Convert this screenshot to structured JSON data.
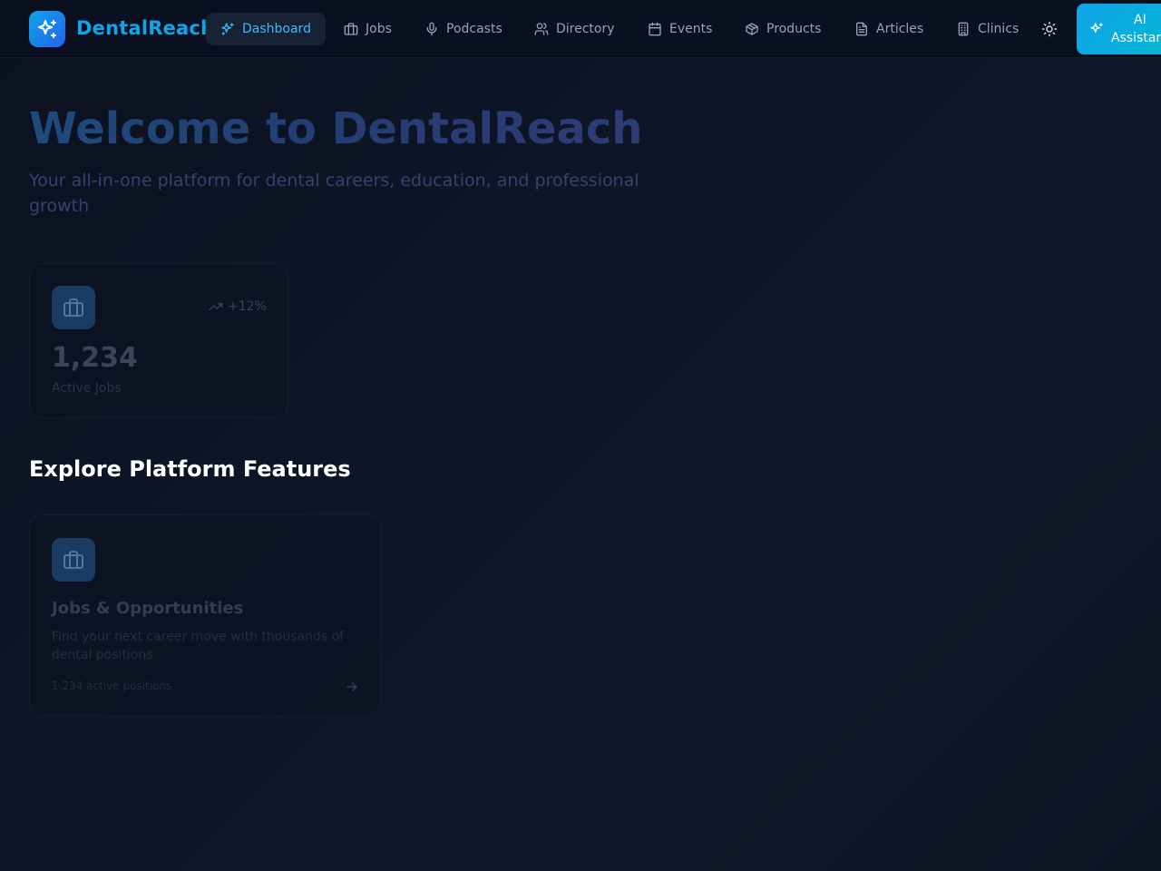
{
  "header": {
    "brand": "DentalReach",
    "nav": [
      {
        "label": "Dashboard",
        "icon": "sparkles-icon",
        "active": true
      },
      {
        "label": "Jobs",
        "icon": "briefcase-icon"
      },
      {
        "label": "Podcasts",
        "icon": "microphone-icon"
      },
      {
        "label": "Directory",
        "icon": "users-icon"
      },
      {
        "label": "Events",
        "icon": "calendar-icon"
      },
      {
        "label": "Products",
        "icon": "package-icon"
      },
      {
        "label": "Articles",
        "icon": "file-text-icon"
      },
      {
        "label": "Clinics",
        "icon": "building-icon"
      }
    ],
    "theme_toggle_icon": "sun-icon",
    "ai_button": {
      "line1": "AI",
      "line2": "Assistant"
    }
  },
  "hero": {
    "title": "Welcome to DentalReach",
    "subtitle": "Your all-in-one platform for dental careers, education, and professional growth"
  },
  "stats": [
    {
      "icon": "briefcase-icon",
      "trend": "+12%",
      "value": "1,234",
      "label": "Active Jobs"
    }
  ],
  "features_section": {
    "title": "Explore Platform Features",
    "cards": [
      {
        "icon": "briefcase-icon",
        "title": "Jobs & Opportunities",
        "description": "Find your next career move with thousands of dental positions",
        "meta": "1,234 active positions"
      }
    ]
  },
  "colors": {
    "accent": "#0ea5e9",
    "background": "#0f172a",
    "active_nav_bg": "#172236"
  }
}
